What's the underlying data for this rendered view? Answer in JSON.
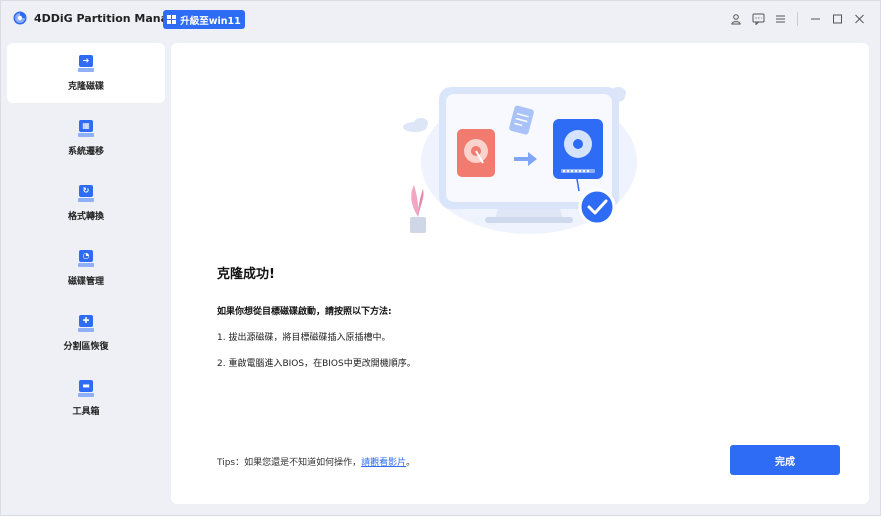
{
  "app": {
    "title": "4DDiG Partition Manager",
    "upgrade_label": "升級至win11"
  },
  "titlebar_icons": [
    "user-icon",
    "feedback-icon",
    "menu-icon",
    "minimize-icon",
    "maximize-icon",
    "close-icon"
  ],
  "sidebar": {
    "items": [
      {
        "label": "克隆磁碟",
        "icon": "clone-disk-icon",
        "active": true
      },
      {
        "label": "系統遷移",
        "icon": "system-migrate-icon",
        "active": false
      },
      {
        "label": "格式轉換",
        "icon": "format-convert-icon",
        "active": false
      },
      {
        "label": "磁碟管理",
        "icon": "disk-manage-icon",
        "active": false
      },
      {
        "label": "分割區恢復",
        "icon": "partition-recovery-icon",
        "active": false
      },
      {
        "label": "工具箱",
        "icon": "toolbox-icon",
        "active": false
      }
    ]
  },
  "main": {
    "title": "克隆成功!",
    "instruction_heading": "如果你想從目標磁碟啟動，請按照以下方法:",
    "step1": "1. 拔出源磁碟，將目標磁碟插入原插槽中。",
    "step2": "2. 重啟電腦進入BIOS，在BIOS中更改開機順序。",
    "tips_prefix": "Tips：如果您還是不知道如何操作，",
    "tips_link": "請觀看影片",
    "tips_suffix": "。",
    "done_label": "完成"
  },
  "colors": {
    "accent": "#2f6cf6",
    "window_bg": "#eef0f6",
    "panel_bg": "#ffffff",
    "source_disk": "#f07b6e",
    "success": "#2f6cf6"
  }
}
